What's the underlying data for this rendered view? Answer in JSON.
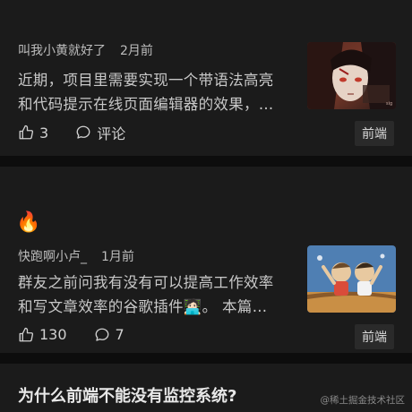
{
  "articles": [
    {
      "author": "叫我小黄就好了",
      "time": "2月前",
      "excerpt_line1": "近期，项目里需要实现一个带语法高亮",
      "excerpt_line2": "和代码提示在线页面编辑器的效果，…",
      "likes": "3",
      "comments": "评论",
      "tag": "前端",
      "thumbnail": "anime-character-illustration"
    },
    {
      "emoji": "🔥",
      "author": "快跑啊小卢_",
      "time": "1月前",
      "excerpt_line1": "群友之前问我有没有可以提高工作效率",
      "excerpt_line2": "和写文章效率的谷歌插件🧑🏻‍💻。 本篇…",
      "likes": "130",
      "comments": "7",
      "tag": "前端",
      "thumbnail": "children-cartoon-illustration"
    },
    {
      "title": "为什么前端不能没有监控系统?"
    }
  ],
  "watermark": "@稀土掘金技术社区",
  "icons": {
    "like": "thumbs-up-icon",
    "comment": "comment-bubble-icon"
  }
}
